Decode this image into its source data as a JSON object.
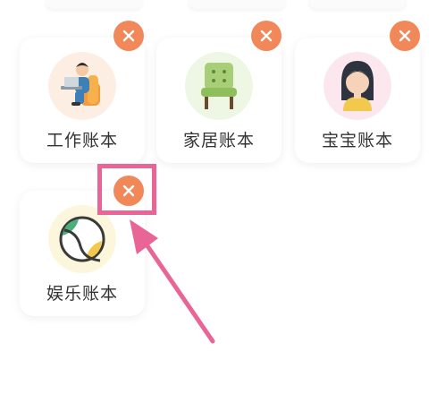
{
  "colors": {
    "delete_button": "#f0885a",
    "highlight": "#e86596",
    "label_text": "#333333"
  },
  "cards": [
    {
      "label": "工作账本",
      "icon": "person-working-laptop-icon"
    },
    {
      "label": "家居账本",
      "icon": "armchair-icon"
    },
    {
      "label": "宝宝账本",
      "icon": "girl-avatar-icon"
    },
    {
      "label": "娱乐账本",
      "icon": "tennis-ball-icon"
    }
  ],
  "annotation": {
    "icon": "arrow-pointing-icon"
  }
}
